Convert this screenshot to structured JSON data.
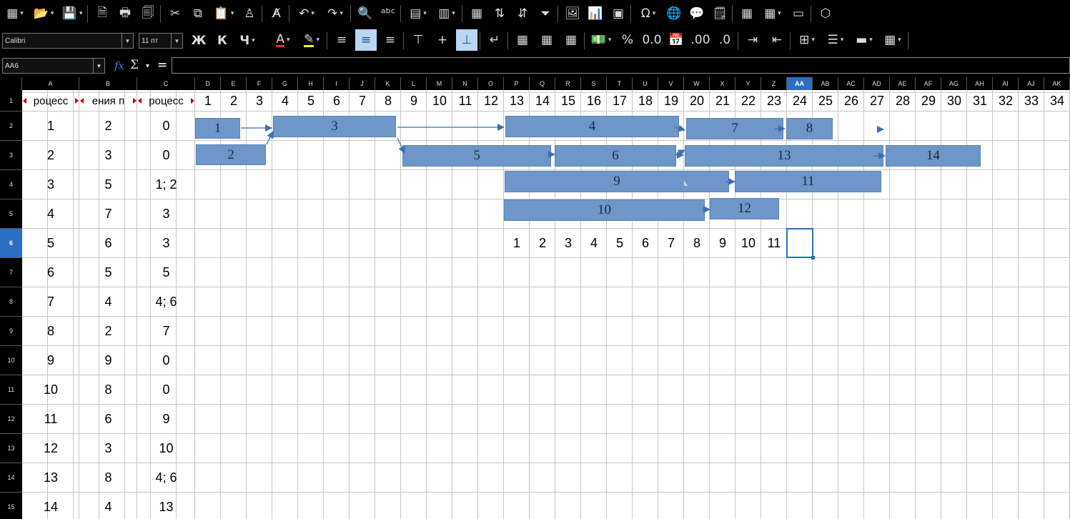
{
  "toolbar1": {
    "items": [
      {
        "name": "new-spreadsheet-icon",
        "glyph": "▦",
        "dd": true
      },
      {
        "name": "open-folder-icon",
        "glyph": "📂",
        "dd": true
      },
      {
        "name": "save-icon",
        "glyph": "💾",
        "dd": true
      },
      {
        "name": "export-pdf-icon",
        "glyph": "🗎"
      },
      {
        "name": "print-icon",
        "glyph": "🖶"
      },
      {
        "name": "print-preview-icon",
        "glyph": "🗐"
      },
      {
        "name": "cut-icon",
        "glyph": "✂"
      },
      {
        "name": "copy-icon",
        "glyph": "⧉"
      },
      {
        "name": "paste-icon",
        "glyph": "📋",
        "dd": true
      },
      {
        "name": "clone-formatting-icon",
        "glyph": "♙"
      },
      {
        "name": "clear-formatting-icon",
        "glyph": "A̸"
      },
      {
        "name": "undo-icon",
        "glyph": "↶",
        "dd": true
      },
      {
        "name": "redo-icon",
        "glyph": "↷",
        "dd": true
      },
      {
        "name": "find-replace-icon",
        "glyph": "🔍"
      },
      {
        "name": "spelling-icon",
        "glyph": "ᵃᵇᶜ"
      },
      {
        "name": "row-icon",
        "glyph": "▤",
        "dd": true
      },
      {
        "name": "column-icon",
        "glyph": "▥",
        "dd": true
      },
      {
        "name": "freeze-icon",
        "glyph": "▦"
      },
      {
        "name": "sort-ascending-icon",
        "glyph": "⇅"
      },
      {
        "name": "sort-descending-icon",
        "glyph": "⇵"
      },
      {
        "name": "autofilter-icon",
        "glyph": "⏷"
      },
      {
        "name": "insert-image-icon",
        "glyph": "🖼"
      },
      {
        "name": "insert-chart-icon",
        "glyph": "📊"
      },
      {
        "name": "pivot-table-icon",
        "glyph": "▣"
      },
      {
        "name": "special-character-icon",
        "glyph": "Ω",
        "dd": true
      },
      {
        "name": "hyperlink-icon",
        "glyph": "🌐"
      },
      {
        "name": "comment-icon",
        "glyph": "💬"
      },
      {
        "name": "header-footer-icon",
        "glyph": "🗒"
      },
      {
        "name": "define-print-area-icon",
        "glyph": "▦"
      },
      {
        "name": "freeze-rows-columns-icon",
        "glyph": "▦",
        "dd": true
      },
      {
        "name": "split-window-icon",
        "glyph": "▭"
      },
      {
        "name": "show-draw-functions-icon",
        "glyph": "⬡"
      }
    ]
  },
  "toolbar2": {
    "font_name": "Calibri",
    "font_size": "11 пт",
    "bold": "Ж",
    "italic": "К",
    "underline": "Ч",
    "items": [
      {
        "name": "font-color-icon",
        "glyph": "A",
        "dd": true,
        "color": "#e03030"
      },
      {
        "name": "highlight-color-icon",
        "glyph": "✎",
        "dd": true,
        "color": "#ffff00"
      },
      {
        "name": "align-left-icon",
        "glyph": "≡"
      },
      {
        "name": "align-center-icon",
        "glyph": "≡",
        "active": true
      },
      {
        "name": "align-right-icon",
        "glyph": "≡"
      },
      {
        "name": "align-top-icon",
        "glyph": "⊤"
      },
      {
        "name": "center-vertically-icon",
        "glyph": "+"
      },
      {
        "name": "align-bottom-icon",
        "glyph": "⊥",
        "active": true
      },
      {
        "name": "wrap-text-icon",
        "glyph": "↵"
      },
      {
        "name": "merge-center-icon",
        "glyph": "▦"
      },
      {
        "name": "merge-cells-icon",
        "glyph": "▦"
      },
      {
        "name": "unmerge-cells-icon",
        "glyph": "▦"
      },
      {
        "name": "currency-format-icon",
        "glyph": "💵",
        "dd": true
      },
      {
        "name": "percent-format-icon",
        "glyph": "%"
      },
      {
        "name": "number-format-icon",
        "glyph": "0.0"
      },
      {
        "name": "date-format-icon",
        "glyph": "📅"
      },
      {
        "name": "add-decimal-icon",
        "glyph": ".00"
      },
      {
        "name": "delete-decimal-icon",
        "glyph": ".0"
      },
      {
        "name": "increase-indent-icon",
        "glyph": "⇥"
      },
      {
        "name": "decrease-indent-icon",
        "glyph": "⇤"
      },
      {
        "name": "borders-icon",
        "glyph": "⊞",
        "dd": true
      },
      {
        "name": "border-style-icon",
        "glyph": "☰",
        "dd": true
      },
      {
        "name": "border-color-icon",
        "glyph": "▬",
        "dd": true
      },
      {
        "name": "conditional-format-icon",
        "glyph": "▦",
        "dd": true
      }
    ]
  },
  "formula_bar": {
    "name_box": "AA6",
    "function_wizard": "fx",
    "sum": "Σ",
    "equals": "=",
    "formula": ""
  },
  "sheet": {
    "selected_column": "AA",
    "selected_row": "6",
    "columns": [
      "A",
      "B",
      "C",
      "D",
      "E",
      "F",
      "G",
      "H",
      "I",
      "J",
      "K",
      "L",
      "M",
      "N",
      "O",
      "P",
      "Q",
      "R",
      "S",
      "T",
      "U",
      "V",
      "W",
      "X",
      "Y",
      "Z",
      "AA",
      "AB",
      "AC",
      "AD",
      "AE",
      "AF",
      "AG",
      "AH",
      "AI",
      "AJ",
      "AK"
    ],
    "rows": [
      "1",
      "2",
      "3",
      "4",
      "5",
      "6",
      "7",
      "8",
      "9",
      "10",
      "11",
      "12",
      "13",
      "14",
      "15"
    ],
    "header_A": "роцесс",
    "header_B": "ения п",
    "header_C": "роцесс",
    "timeline": [
      "1",
      "2",
      "3",
      "4",
      "5",
      "6",
      "7",
      "8",
      "9",
      "10",
      "11",
      "12",
      "13",
      "14",
      "15",
      "16",
      "17",
      "18",
      "19",
      "20",
      "21",
      "22",
      "23",
      "24",
      "25",
      "26",
      "27",
      "28",
      "29",
      "30",
      "31",
      "32",
      "33",
      "34"
    ],
    "table": [
      {
        "a": "1",
        "b": "2",
        "c": "0"
      },
      {
        "a": "2",
        "b": "3",
        "c": "0"
      },
      {
        "a": "3",
        "b": "5",
        "c": "1; 2"
      },
      {
        "a": "4",
        "b": "7",
        "c": "3"
      },
      {
        "a": "5",
        "b": "6",
        "c": "3"
      },
      {
        "a": "6",
        "b": "5",
        "c": "5"
      },
      {
        "a": "7",
        "b": "4",
        "c": "4; 6"
      },
      {
        "a": "8",
        "b": "2",
        "c": "7"
      },
      {
        "a": "9",
        "b": "9",
        "c": "0"
      },
      {
        "a": "10",
        "b": "8",
        "c": "0"
      },
      {
        "a": "11",
        "b": "6",
        "c": "9"
      },
      {
        "a": "12",
        "b": "3",
        "c": "10"
      },
      {
        "a": "13",
        "b": "8",
        "c": "4; 6"
      },
      {
        "a": "14",
        "b": "4",
        "c": "13"
      }
    ],
    "row6_numbers": [
      "1",
      "2",
      "3",
      "4",
      "5",
      "6",
      "7",
      "8",
      "9",
      "10",
      "11"
    ],
    "gantt_bars": [
      {
        "label": "1"
      },
      {
        "label": "2"
      },
      {
        "label": "3"
      },
      {
        "label": "4"
      },
      {
        "label": "5"
      },
      {
        "label": "6"
      },
      {
        "label": "7"
      },
      {
        "label": "8"
      },
      {
        "label": "9"
      },
      {
        "label": "10"
      },
      {
        "label": "11"
      },
      {
        "label": "12"
      },
      {
        "label": "13"
      },
      {
        "label": "14"
      }
    ],
    "bar_color": "#6f96c8",
    "arrow_color": "#3d6fb0"
  }
}
